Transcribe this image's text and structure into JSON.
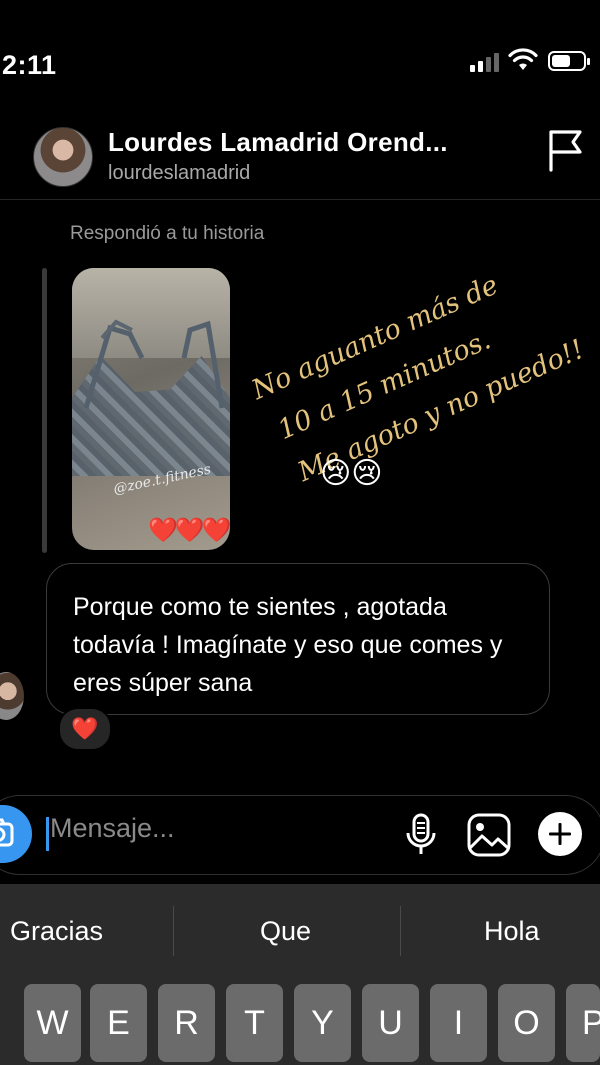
{
  "status_bar": {
    "time": "2:11"
  },
  "header": {
    "contact_name": "Lourdes Lamadrid Orend...",
    "username": "lourdeslamadrid"
  },
  "conversation": {
    "reply_label": "Respondió a tu historia",
    "story_text_lines": [
      "No aguanto más de",
      "10 a 15 minutos.",
      "Me agoto y no puedo!!"
    ],
    "story_emojis": "😢😢",
    "story_watermark": "@zoe.t.fitness",
    "story_hearts": "❤️❤️❤️",
    "message_text": "Porque como te sientes , agotada todavía ! Imagínate y eso que comes y eres súper sana",
    "reaction": "❤️"
  },
  "composer": {
    "placeholder": "Mensaje..."
  },
  "keyboard": {
    "suggestions": [
      "Gracias",
      "Que",
      "Hola"
    ],
    "keys": [
      "W",
      "E",
      "R",
      "T",
      "Y",
      "U",
      "I",
      "O",
      "P"
    ]
  },
  "colors": {
    "accent": "#3797f0",
    "story_text": "#e3c27c",
    "background": "#000000"
  }
}
